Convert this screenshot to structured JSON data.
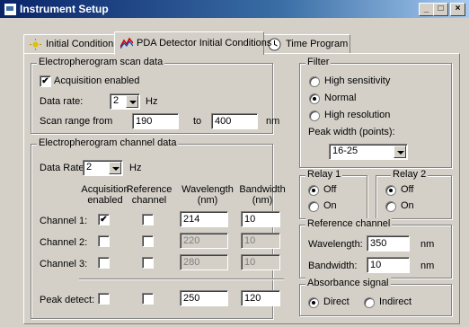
{
  "window": {
    "title": "Instrument Setup",
    "min": "_",
    "max": "□",
    "close": "×"
  },
  "tabs": [
    {
      "label": "Initial Conditions"
    },
    {
      "label": "PDA Detector Initial Conditions"
    },
    {
      "label": "Time Program"
    }
  ],
  "scan": {
    "legend": "Electropherogram scan data",
    "acq_label": "Acquisition enabled",
    "acq_checked": "✔",
    "rate_label": "Data rate:",
    "rate_value": "2",
    "rate_unit": "Hz",
    "range_label": "Scan range from",
    "range_from": "190",
    "range_to_label": "to",
    "range_to": "400",
    "range_unit": "nm"
  },
  "channel": {
    "legend": "Electropherogram channel data",
    "rate_label": "Data Rate:",
    "rate_value": "2",
    "rate_unit": "Hz",
    "headers": {
      "acq": [
        "Acquisition",
        "enabled"
      ],
      "ref": [
        "Reference",
        "channel"
      ],
      "wl": [
        "Wavelength",
        "(nm)"
      ],
      "bw": [
        "Bandwidth",
        "(nm)"
      ]
    },
    "rows": [
      {
        "label": "Channel 1:",
        "acq": "✔",
        "ref": "",
        "wavelength": "214",
        "bandwidth": "10"
      },
      {
        "label": "Channel 2:",
        "acq": "",
        "ref": "",
        "wavelength": "220",
        "bandwidth": "10"
      },
      {
        "label": "Channel 3:",
        "acq": "",
        "ref": "",
        "wavelength": "280",
        "bandwidth": "10"
      }
    ],
    "peak": {
      "label": "Peak detect:",
      "acq": "",
      "ref": "",
      "wavelength": "250",
      "bandwidth": "120"
    }
  },
  "filter": {
    "legend": "Filter",
    "options": [
      "High sensitivity",
      "Normal",
      "High resolution"
    ],
    "peak_label": "Peak width (points):",
    "peak_value": "16-25"
  },
  "relay1": {
    "legend": "Relay 1",
    "off": "Off",
    "on": "On"
  },
  "relay2": {
    "legend": "Relay 2",
    "off": "Off",
    "on": "On"
  },
  "refchan": {
    "legend": "Reference channel",
    "wl_label": "Wavelength:",
    "wl_value": "350",
    "wl_unit": "nm",
    "bw_label": "Bandwidth:",
    "bw_value": "10",
    "bw_unit": "nm"
  },
  "absorb": {
    "legend": "Absorbance signal",
    "direct": "Direct",
    "indirect": "Indirect"
  }
}
